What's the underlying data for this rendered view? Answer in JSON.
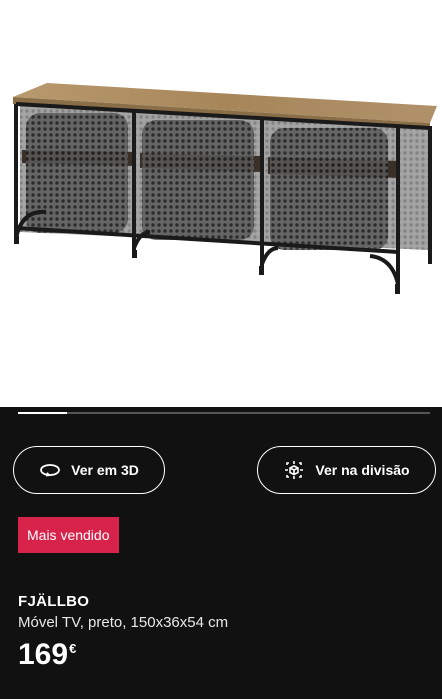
{
  "gallery": {
    "image_alt": "FJÄLLBO Móvel TV",
    "progress_fraction": 0.12
  },
  "actions": {
    "view_3d_label": "Ver em 3D",
    "view_3d_icon": "rotate-3d-icon",
    "view_in_room_label": "Ver na divisão",
    "view_in_room_icon": "ar-room-icon"
  },
  "badge": {
    "label": "Mais vendido",
    "color": "#d7234a"
  },
  "product": {
    "name": "FJÄLLBO",
    "description": "Móvel TV, preto, 150x36x54 cm",
    "price": "169",
    "currency": "€"
  }
}
